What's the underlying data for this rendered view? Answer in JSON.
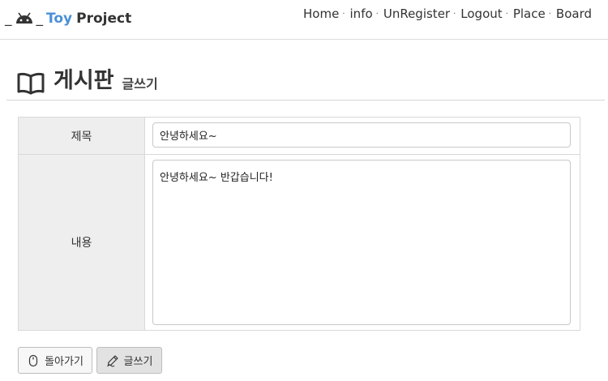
{
  "brand": {
    "prefix": "_",
    "suffix": "_",
    "toy": "Toy",
    "project": "Project",
    "toy_color": "#4a90d9"
  },
  "nav": {
    "items": [
      "Home",
      "info",
      "UnRegister",
      "Logout",
      "Place",
      "Board"
    ],
    "separator": "·"
  },
  "page": {
    "title": "게시판",
    "subtitle": "글쓰기",
    "title_icon": "book-open-icon"
  },
  "form": {
    "title_label": "제목",
    "title_value": "안녕하세요~",
    "content_label": "내용",
    "content_value": "안녕하세요~ 반갑습니다!"
  },
  "buttons": {
    "back": {
      "label": "돌아가기",
      "icon": "mouse-icon"
    },
    "write": {
      "label": "글쓰기",
      "icon": "pencil-icon"
    }
  }
}
